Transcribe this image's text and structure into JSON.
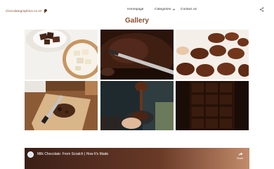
{
  "header": {
    "logo_text": "chocolategraphics.co.nz",
    "nav": {
      "homepage": "Homepage",
      "categories": "Categories",
      "contact": "Contact us"
    }
  },
  "gallery": {
    "title": "Gallery",
    "images": [
      {
        "subject": "chocolate pieces and white chocolate"
      },
      {
        "subject": "chocolate brownie with knife"
      },
      {
        "subject": "chocolate cups"
      },
      {
        "subject": "chopped chocolate on board"
      },
      {
        "subject": "chocolate drizzle from spoon"
      },
      {
        "subject": "chocolate bar"
      }
    ]
  },
  "video": {
    "title": "Milk Chocolate: From Scratch | How It's Made",
    "share_label": "Share"
  },
  "colors": {
    "brand": "#8a4b2c",
    "nav_text": "#333333"
  }
}
